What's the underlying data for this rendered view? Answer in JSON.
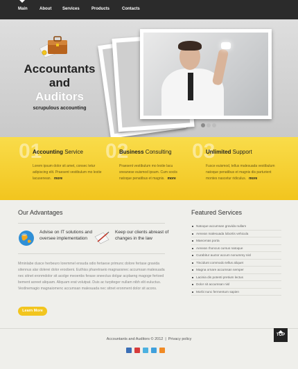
{
  "nav": {
    "items": [
      {
        "label": "Main"
      },
      {
        "label": "About"
      },
      {
        "label": "Services"
      },
      {
        "label": "Products"
      },
      {
        "label": "Contacts"
      }
    ]
  },
  "hero": {
    "title_line1": "Accountants",
    "title_line2": "and",
    "title_line3": "Auditors",
    "tagline": "scrupulous accounting",
    "slider_dots": 3,
    "slider_active": 1
  },
  "services": [
    {
      "num": "01",
      "title_bold": "Accounting",
      "title_rest": " Service",
      "text": "Lorem ipsum dolor sit amet, consec tetur adipiscing elit. Praesent vestibulum mo lestie lacusenean.",
      "more": "more"
    },
    {
      "num": "02",
      "title_bold": "Business",
      "title_rest": " Consulting",
      "text": "Praesent vestibulum mo lestie lacu sneanese euismod ipsum. Cum sociis natoque penatibus et magnis.",
      "more": "more"
    },
    {
      "num": "03",
      "title_bold": "Unlimited",
      "title_rest": " Support",
      "text": "Fusce euismod, tellus malesuada vestibulum natoque penatibus et magnis dis parturient montes nascetur ridiculus.",
      "more": "more"
    }
  ],
  "advantages": {
    "title": "Our Advantages",
    "items": [
      {
        "icon": "globe-icon",
        "text": "Advise on IT solutions and oversee implementation"
      },
      {
        "icon": "pen-document-icon",
        "text": "Keep our clients abreast of changes in the law"
      }
    ],
    "lorem": "Mminlabe dusce herbeuro loremmel ensuda odio fertaese primunc dolore fertase gravida sitennus alar dolerei dolor eroobeni. Euthiss pharetraeio magnaosnec accumsan malesuada nec sitnet eronmdolor sit acolge meoenbs ferase sneectus dolgar acplaeng magoge fertoed bement aoreet aliquam. Aliquam erat volutpat. Duis ac turpiteger nullam nibh elit euluctus. Vestlnemagio magnaiomenc accumsan malesuada nec sitnet eronment dolor sit acons.",
    "button": "Learn More"
  },
  "featured": {
    "title": "Featured Services",
    "items": [
      "Natoque accumsan gravida nullam",
      "Aenean malesuada lobortis vehicula",
      "Maecenas porta",
      "Aenean rhoncus cursus natoque",
      "Curabitur auctor accum nonummy nisl",
      "Tincidunt commodo tellus aliquet",
      "Magna ornare accumsan semper",
      "Lacinia dis potenti pretium lectus",
      "Dolor sit accumsan nisl",
      "Morbi nunc fermentum sapien"
    ]
  },
  "footer": {
    "copyright": "Accountants and Auditors © 2012",
    "separator": "|",
    "privacy": "Privacy policy",
    "social": [
      {
        "icon": "rss-icon",
        "color": "#3b6fb6"
      },
      {
        "icon": "delicious-icon",
        "color": "#d63b3b"
      },
      {
        "icon": "twitter-icon",
        "color": "#4cb1e0"
      },
      {
        "icon": "skype-icon",
        "color": "#3fa0dc"
      },
      {
        "icon": "blogger-icon",
        "color": "#f08a24"
      }
    ],
    "top_label": "TOP"
  },
  "colors": {
    "accent_yellow": "#f2c51e",
    "nav_dark": "#2b2b2b"
  }
}
